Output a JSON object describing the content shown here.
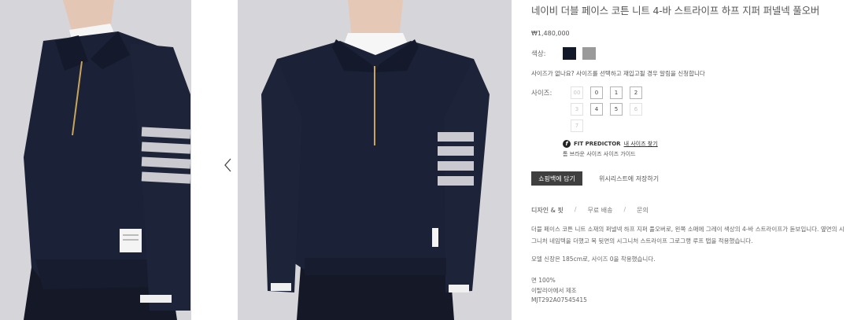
{
  "gallery": {
    "images": [
      {
        "alt": "side view of navy half-zip pullover"
      },
      {
        "alt": "front view of navy half-zip pullover"
      }
    ],
    "prev_icon": "chevron-left-icon",
    "next_icon": "chevron-right-icon"
  },
  "product": {
    "title": "네이비 더블 페이스 코튼 니트 4-바 스트라이프 하프 지퍼 퍼넬넥 풀오버",
    "price": "₩1,480,000",
    "color_label": "색상:",
    "colors": [
      {
        "name": "navy",
        "hex": "#14192a"
      },
      {
        "name": "grey",
        "hex": "#9a9a9a"
      }
    ],
    "size_notice": "사이즈가 없나요? 사이즈를 선택하고 재입고될 경우 알림을 신청합니다",
    "size_label": "사이즈:",
    "sizes": [
      {
        "label": "00",
        "available": false
      },
      {
        "label": "0",
        "available": true
      },
      {
        "label": "1",
        "available": true
      },
      {
        "label": "2",
        "available": true
      },
      {
        "label": "3",
        "available": false
      },
      {
        "label": "4",
        "available": true
      },
      {
        "label": "5",
        "available": true
      },
      {
        "label": "6",
        "available": false
      },
      {
        "label": "7",
        "available": false
      }
    ],
    "fit_predictor": {
      "brand": "FIT PREDICTOR",
      "link": "내 사이즈 찾기",
      "guide": "톰 브라운 사이즈 사이즈 가이드"
    },
    "add_to_bag": "쇼핑백에 담기",
    "wishlist": "위시리스트에 저장하기",
    "tabs": [
      "디자인 & 핏",
      "무료 배송",
      "문의"
    ],
    "description": "더블 페이스 코튼 니트 소재의 퍼넬넥 하프 지퍼 풀오버로, 왼쪽 소매에 그레이 색상의 4-바 스트라이프가 돋보입니다. 옆면의 시그니처 네임텍을 더했고 목 뒷면의 시그니처 스트라이프 그로그랭 루프 탭을 적용했습니다.",
    "model_info": "모델 신장은 185cm로, 사이즈 0을 착용했습니다.",
    "composition": "면 100%",
    "origin": "이탈리아에서 제조",
    "sku": "MJT292A07545415"
  }
}
